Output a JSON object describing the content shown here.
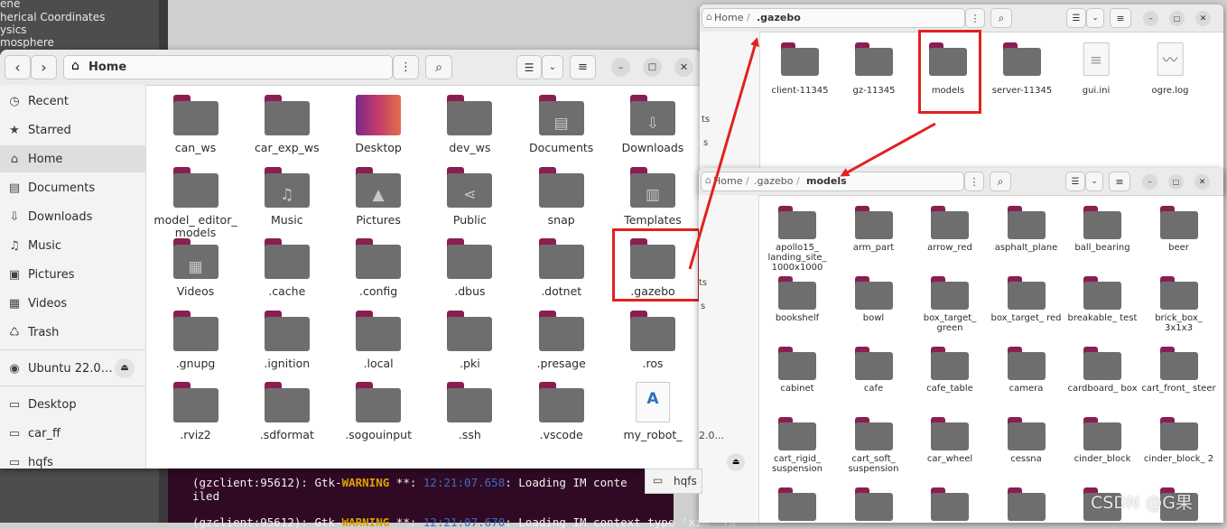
{
  "background": {
    "left_lines": [
      "ene",
      "herical Coordinates",
      "ysics",
      "mosphere"
    ],
    "terminal_lines": [
      {
        "pre": "(gzclient:95612): Gtk-",
        "warn": "WARNING",
        "mid": " **: ",
        "time": "12:21:07.658",
        "post": ": Loading IM conte"
      },
      {
        "pre": "iled",
        "warn": "",
        "mid": "",
        "time": "",
        "post": ""
      },
      {
        "pre": "(gzclient:95612): Gtk-",
        "warn": "WARNING",
        "mid": " **: ",
        "time": "12:21:07.670",
        "post": ": Loading IM context type 'xim' fa"
      }
    ]
  },
  "home_window": {
    "title": "Home",
    "sidebar": [
      {
        "icon": "clock-icon",
        "glyph": "◷",
        "label": "Recent"
      },
      {
        "icon": "star-icon",
        "glyph": "★",
        "label": "Starred"
      },
      {
        "icon": "home-icon",
        "glyph": "⌂",
        "label": "Home",
        "active": true
      },
      {
        "icon": "document-icon",
        "glyph": "▤",
        "label": "Documents"
      },
      {
        "icon": "download-icon",
        "glyph": "⇩",
        "label": "Downloads"
      },
      {
        "icon": "music-icon",
        "glyph": "♫",
        "label": "Music"
      },
      {
        "icon": "picture-icon",
        "glyph": "▣",
        "label": "Pictures"
      },
      {
        "icon": "video-icon",
        "glyph": "▦",
        "label": "Videos"
      },
      {
        "icon": "trash-icon",
        "glyph": "♺",
        "label": "Trash"
      },
      {
        "icon": "disk-icon",
        "glyph": "◉",
        "label": "Ubuntu 22.0…",
        "eject": "⏏"
      },
      {
        "icon": "folder-icon",
        "glyph": "▭",
        "label": "Desktop"
      },
      {
        "icon": "folder-icon",
        "glyph": "▭",
        "label": "car_ff"
      },
      {
        "icon": "folder-icon",
        "glyph": "▭",
        "label": "hqfs"
      }
    ],
    "items": [
      {
        "label": "can_ws"
      },
      {
        "label": "car_exp_ws"
      },
      {
        "label": "Desktop",
        "type": "desktop"
      },
      {
        "label": "dev_ws"
      },
      {
        "label": "Documents",
        "emblem": "▤"
      },
      {
        "label": "Downloads",
        "emblem": "⇩"
      },
      {
        "label": "model_ editor_ models"
      },
      {
        "label": "Music",
        "emblem": "♫"
      },
      {
        "label": "Pictures",
        "emblem": "▲"
      },
      {
        "label": "Public",
        "emblem": "⋖"
      },
      {
        "label": "snap"
      },
      {
        "label": "Templates",
        "emblem": "▥"
      },
      {
        "label": "Videos",
        "emblem": "▦"
      },
      {
        "label": ".cache"
      },
      {
        "label": ".config"
      },
      {
        "label": ".dbus"
      },
      {
        "label": ".dotnet"
      },
      {
        "label": ".gazebo",
        "highlight": true
      },
      {
        "label": ".gnupg"
      },
      {
        "label": ".ignition"
      },
      {
        "label": ".local"
      },
      {
        "label": ".pki"
      },
      {
        "label": ".presage"
      },
      {
        "label": ".ros"
      },
      {
        "label": ".rviz2"
      },
      {
        "label": ".sdformat"
      },
      {
        "label": ".sogouinput"
      },
      {
        "label": ".ssh"
      },
      {
        "label": ".vscode"
      },
      {
        "label": "my_robot_",
        "type": "file"
      }
    ]
  },
  "gazebo_window": {
    "breadcrumb": [
      "Home",
      ".gazebo"
    ],
    "sidebar_partial": [
      "ts",
      "s"
    ],
    "items": [
      {
        "label": "client-11345"
      },
      {
        "label": "gz-11345"
      },
      {
        "label": "models",
        "highlight": true
      },
      {
        "label": "server-11345"
      },
      {
        "label": "gui.ini",
        "type": "file"
      },
      {
        "label": "ogre.log",
        "type": "log"
      }
    ]
  },
  "models_window": {
    "breadcrumb": [
      "Home",
      ".gazebo",
      "models"
    ],
    "sidebar_partial": [
      "ts",
      "s",
      "2.0...",
      "hqfs"
    ],
    "items": [
      {
        "label": "apollo15_ landing_site_ 1000x1000"
      },
      {
        "label": "arm_part"
      },
      {
        "label": "arrow_red"
      },
      {
        "label": "asphalt_plane"
      },
      {
        "label": "ball_bearing"
      },
      {
        "label": "beer"
      },
      {
        "label": "bookshelf"
      },
      {
        "label": "bowl"
      },
      {
        "label": "box_target_ green"
      },
      {
        "label": "box_target_ red"
      },
      {
        "label": "breakable_ test"
      },
      {
        "label": "brick_box_ 3x1x3"
      },
      {
        "label": "cabinet"
      },
      {
        "label": "cafe"
      },
      {
        "label": "cafe_table"
      },
      {
        "label": "camera"
      },
      {
        "label": "cardboard_ box"
      },
      {
        "label": "cart_front_ steer"
      },
      {
        "label": "cart_rigid_ suspension"
      },
      {
        "label": "cart_soft_ suspension"
      },
      {
        "label": "car_wheel"
      },
      {
        "label": "cessna"
      },
      {
        "label": "cinder_block"
      },
      {
        "label": "cinder_block_ 2"
      },
      {
        "label": ""
      },
      {
        "label": ""
      },
      {
        "label": ""
      },
      {
        "label": ""
      },
      {
        "label": ""
      },
      {
        "label": ""
      }
    ]
  },
  "watermark": "CSDN @G果",
  "colors": {
    "folder_tab": "#8a1e52",
    "folder_body": "#6e6e6e",
    "highlight": "#e32020",
    "terminal_bg": "#300a24"
  }
}
